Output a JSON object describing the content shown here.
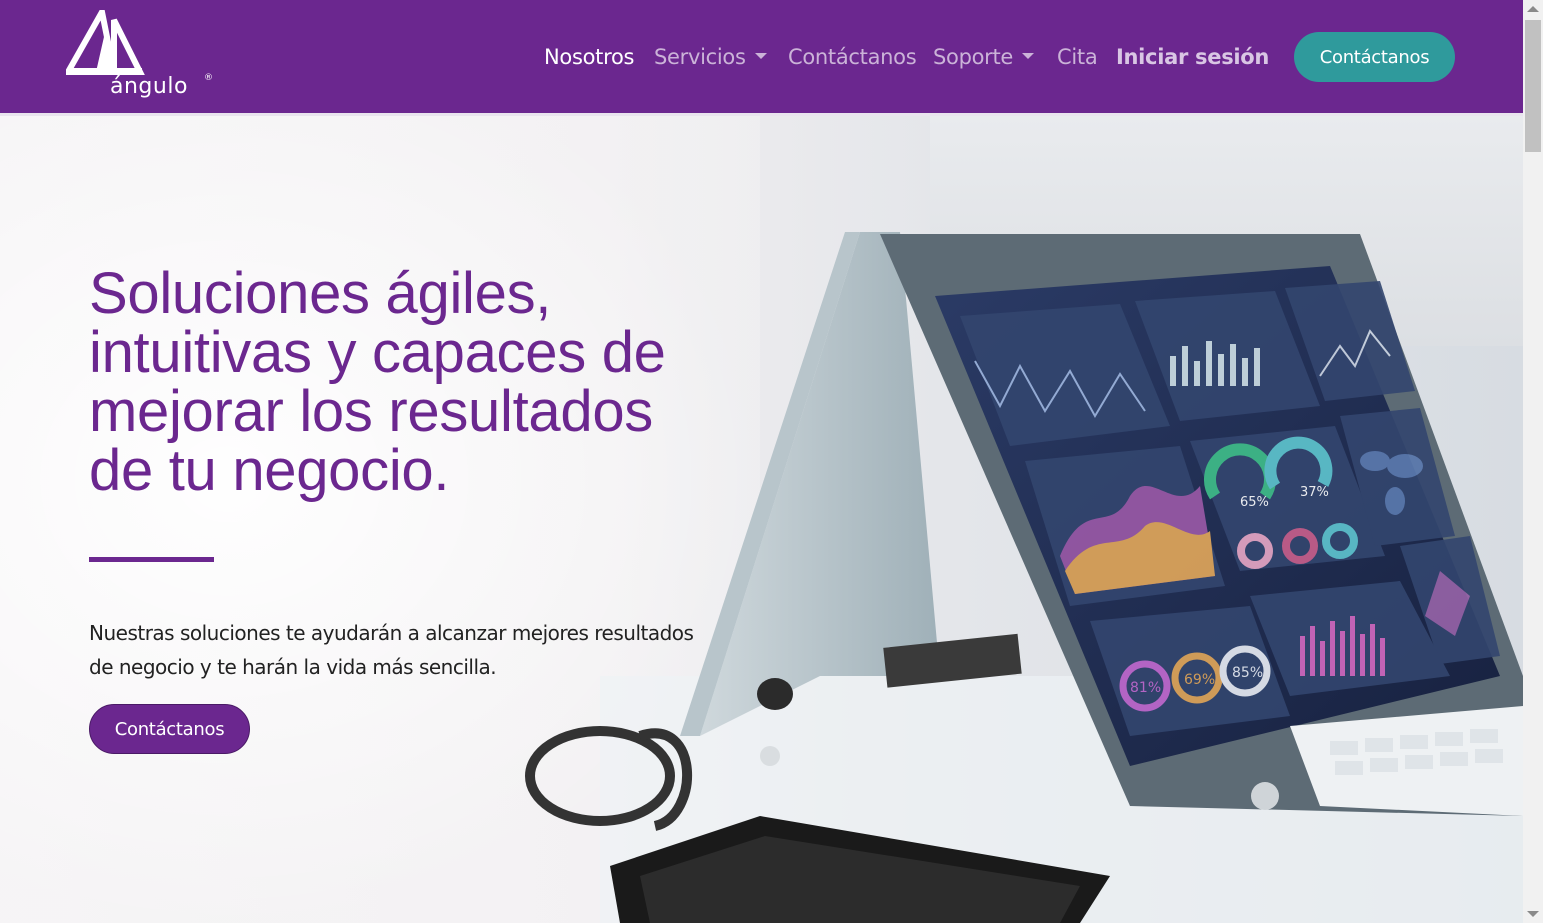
{
  "brand": {
    "logo_text": "ángulo",
    "registered_mark": "®",
    "colors": {
      "primary": "#6b278f",
      "accent": "#2f9a9c"
    }
  },
  "nav": {
    "items": [
      {
        "label": "Nosotros",
        "active": true
      },
      {
        "label": "Servicios",
        "dropdown": true
      },
      {
        "label": "Contáctanos"
      },
      {
        "label": "Soporte",
        "dropdown": true
      },
      {
        "label": "Cita"
      },
      {
        "label": "Iniciar sesión"
      }
    ],
    "cta_label": "Contáctanos"
  },
  "hero": {
    "title": "Soluciones ágiles, intuitivas y capaces de mejorar los resultados de tu negocio.",
    "subtitle": "Nuestras soluciones te ayudarán a alcanzar mejores resultados de negocio y te harán la vida más sencilla.",
    "cta_label": "Contáctanos",
    "image_labels": {
      "gauge_1": "65%",
      "gauge_2": "37%",
      "ring_1": "81%",
      "ring_2": "69%",
      "ring_3": "85%"
    }
  }
}
